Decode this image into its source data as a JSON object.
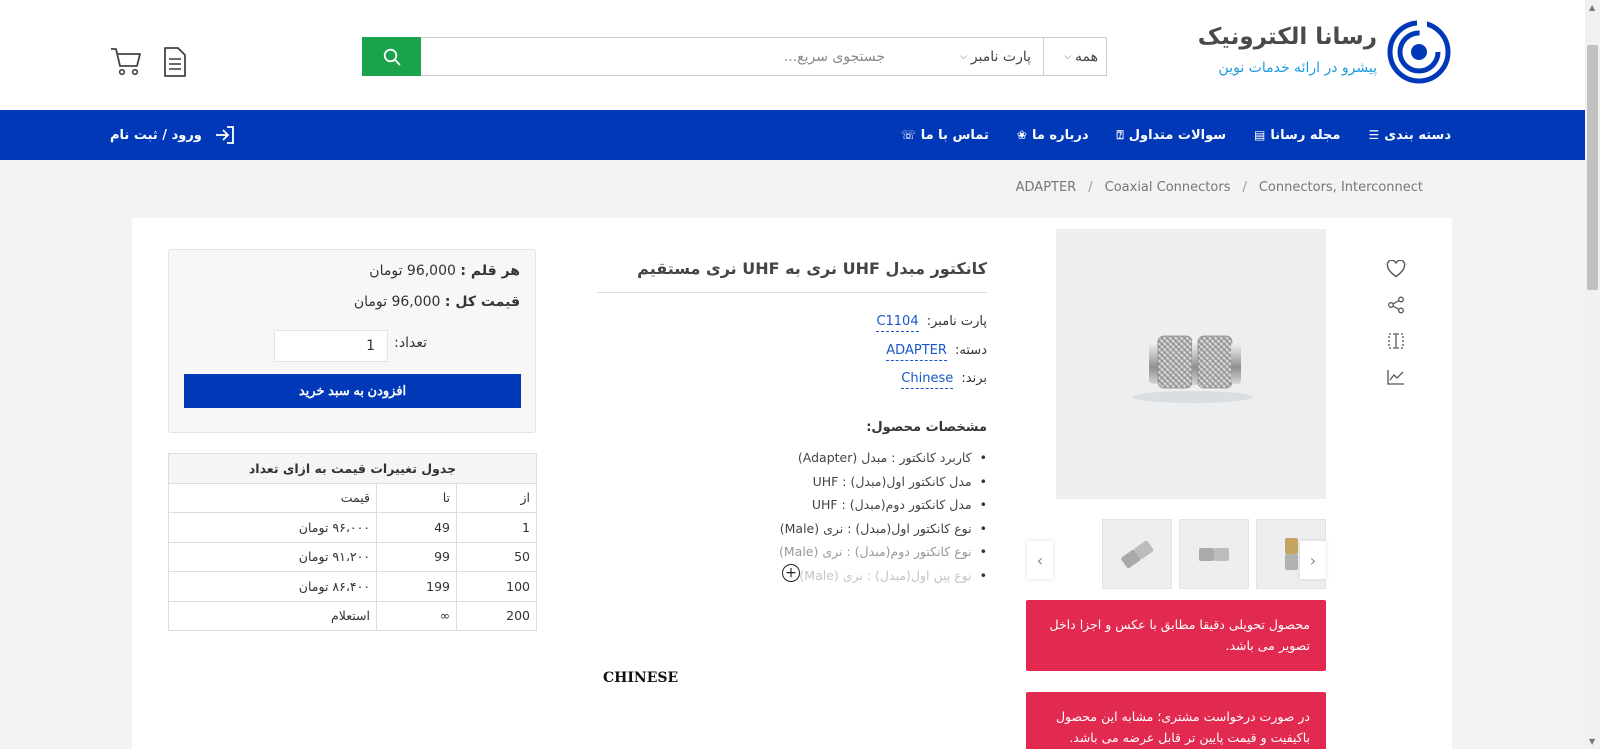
{
  "header": {
    "logo_title": "رسانا الکترونیک",
    "logo_subtitle": "پیشرو در ارائه خدمات نوین",
    "search_placeholder": "جستجوی سریع...",
    "search_filter_part": "پارت نامبر",
    "search_filter_all": "همه"
  },
  "nav": {
    "items": [
      {
        "label": "دسته بندی",
        "icon": "menu-icon"
      },
      {
        "label": "مجله رسانا",
        "icon": "newspaper-icon"
      },
      {
        "label": "سوالات متداول",
        "icon": "question-icon"
      },
      {
        "label": "درباره ما",
        "icon": "award-icon"
      },
      {
        "label": "تماس با ما",
        "icon": "contact-icon"
      }
    ],
    "login": "ورود / ثبت نام"
  },
  "breadcrumb": [
    "Connectors, Interconnect",
    "Coaxial Connectors",
    "ADAPTER"
  ],
  "product": {
    "title": "کانکتور مبدل UHF نری به UHF نری مستقیم",
    "part_label": "پارت نامبر:",
    "part_value": "C1104",
    "category_label": "دسته:",
    "category_value": "ADAPTER",
    "brand_label": "برند:",
    "brand_value": "Chinese",
    "specs_title": "مشخصات محصول:",
    "specs": [
      "کاربرد کانکتور : مبدل (Adapter)",
      "مدل کانکتور اول(مبدل) : UHF",
      "مدل کانکتور دوم(مبدل) : UHF",
      "نوع کانکتور اول(مبدل) : نری (Male)",
      "نوع کانکتور دوم(مبدل) : نری (Male)",
      "نوع پین اول(مبدل) : نری (Male)"
    ],
    "brand_big": "CHINESE"
  },
  "price_box": {
    "unit_label": "هر قلم :",
    "unit_value": "96,000 تومان",
    "total_label": "قیمت کل :",
    "total_value": "96,000 تومان",
    "qty_label": "تعداد:",
    "qty_value": "1",
    "add_button": "افزودن به سبد خرید"
  },
  "price_table": {
    "caption": "جدول تغییرات قیمت به ازای تعداد",
    "headers": {
      "from": "از",
      "to": "تا",
      "price": "قیمت"
    },
    "rows": [
      {
        "from": "1",
        "to": "49",
        "price": "۹۶،۰۰۰ تومان"
      },
      {
        "from": "50",
        "to": "99",
        "price": "۹۱،۲۰۰ تومان"
      },
      {
        "from": "100",
        "to": "199",
        "price": "۸۶،۴۰۰ تومان"
      },
      {
        "from": "200",
        "to": "∞",
        "price": "استعلام"
      }
    ]
  },
  "notices": [
    "محصول تحویلی دقیقا مطابق با عکس و اجزا داخل تصویر می باشد.",
    "در صورت درخواست مشتری؛ مشابه این محصول باکیفیت و قیمت پایین تر قابل عرضه می باشد."
  ],
  "colors": {
    "primary": "#0038b8",
    "search_button": "#1aa34a",
    "notice": "#e2294f",
    "logo_blue": "#0038b8",
    "subtitle": "#1a9be0"
  }
}
